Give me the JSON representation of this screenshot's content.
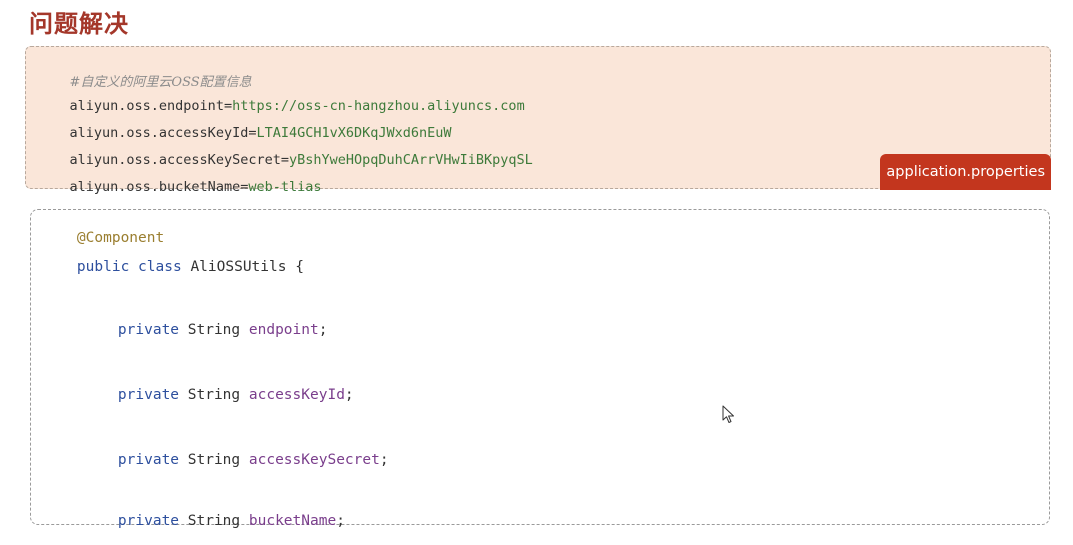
{
  "heading": "问题解决",
  "properties": {
    "comment": "#自定义的阿里云OSS配置信息",
    "lines": [
      {
        "key": "aliyun.oss.endpoint",
        "eq": "=",
        "value": "https://oss-cn-hangzhou.aliyuncs.com"
      },
      {
        "key": "aliyun.oss.accessKeyId",
        "eq": "=",
        "value": "LTAI4GCH1vX6DKqJWxd6nEuW"
      },
      {
        "key": "aliyun.oss.accessKeySecret",
        "eq": "=",
        "value": "yBshYweHOpqDuhCArrVHwIiBKpyqSL"
      },
      {
        "key": "aliyun.oss.bucketName",
        "eq": "=",
        "value": "web-tlias"
      }
    ],
    "file_tag": "application.properties"
  },
  "code": {
    "annotation": "@Component",
    "class_decl": {
      "kw1": "public",
      "kw2": "class",
      "name": "AliOSSUtils",
      "brace": "{"
    },
    "fields": [
      {
        "modifier": "private",
        "type": "String",
        "name": "endpoint",
        "semi": ";"
      },
      {
        "modifier": "private",
        "type": "String",
        "name": "accessKeyId",
        "semi": ";"
      },
      {
        "modifier": "private",
        "type": "String",
        "name": "accessKeySecret",
        "semi": ";"
      },
      {
        "modifier": "private",
        "type": "String",
        "name": "bucketName",
        "semi": ";"
      }
    ]
  },
  "icons": {
    "cursor": "mouse-pointer-icon"
  }
}
